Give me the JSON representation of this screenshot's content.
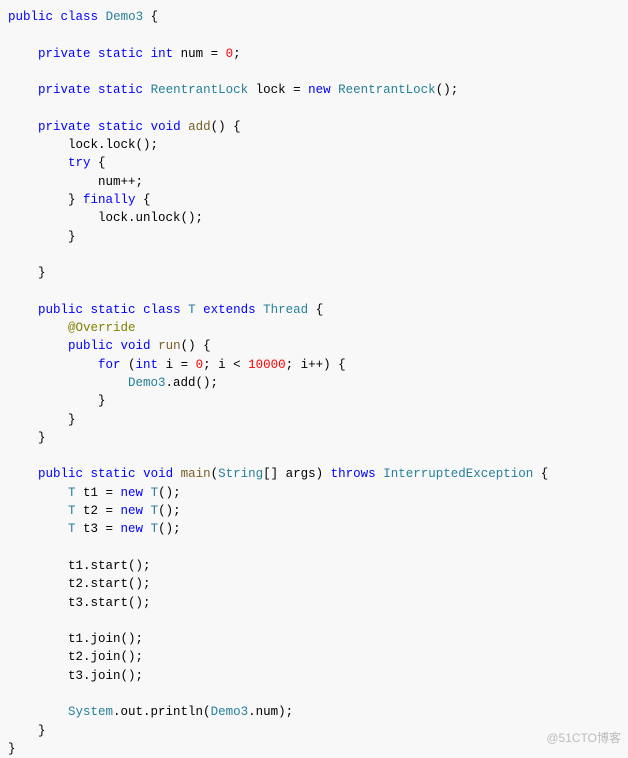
{
  "code": {
    "l1": {
      "t1": "public",
      "t2": "class",
      "t3": "Demo3",
      "t4": " {"
    },
    "l3": {
      "t1": "private",
      "t2": "static",
      "t3": "int",
      "t4": " num = ",
      "t5": "0",
      "t6": ";"
    },
    "l5": {
      "t1": "private",
      "t2": "static",
      "t3": "ReentrantLock",
      "t4": " lock = ",
      "t5": "new",
      "t6": "ReentrantLock",
      "t7": "();"
    },
    "l7": {
      "t1": "private",
      "t2": "static",
      "t3": "void",
      "t4": "add",
      "t5": "() {"
    },
    "l8": {
      "t1": "        lock.lock();"
    },
    "l9": {
      "t1": "try",
      "t2": " {"
    },
    "l10": {
      "t1": "            num++;"
    },
    "l11": {
      "t1": "} ",
      "t2": "finally",
      "t3": " {"
    },
    "l12": {
      "t1": "            lock.unlock();"
    },
    "l13": {
      "t1": "        }"
    },
    "l15": {
      "t1": "    }"
    },
    "l17": {
      "t1": "public",
      "t2": "static",
      "t3": "class",
      "t4": "T",
      "t5": "extends",
      "t6": "Thread",
      "t7": " {"
    },
    "l18": {
      "t1": "@Override"
    },
    "l19": {
      "t1": "public",
      "t2": "void",
      "t3": "run",
      "t4": "() {"
    },
    "l20": {
      "t1": "for",
      "t2": " (",
      "t3": "int",
      "t4": " i = ",
      "t5": "0",
      "t6": "; i < ",
      "t7": "10000",
      "t8": "; i++) {"
    },
    "l21": {
      "t1": "Demo3",
      "t2": ".add();"
    },
    "l22": {
      "t1": "            }"
    },
    "l23": {
      "t1": "        }"
    },
    "l24": {
      "t1": "    }"
    },
    "l26": {
      "t1": "public",
      "t2": "static",
      "t3": "void",
      "t4": "main",
      "t5": "(",
      "t6": "String",
      "t7": "[] args) ",
      "t8": "throws",
      "t9": "InterruptedException",
      "t10": " {"
    },
    "l27": {
      "t1": "T",
      "t2": " t1 = ",
      "t3": "new",
      "t4": "T",
      "t5": "();"
    },
    "l28": {
      "t1": "T",
      "t2": " t2 = ",
      "t3": "new",
      "t4": "T",
      "t5": "();"
    },
    "l29": {
      "t1": "T",
      "t2": " t3 = ",
      "t3": "new",
      "t4": "T",
      "t5": "();"
    },
    "l31": {
      "t1": "        t1.start();"
    },
    "l32": {
      "t1": "        t2.start();"
    },
    "l33": {
      "t1": "        t3.start();"
    },
    "l35": {
      "t1": "        t1.join();"
    },
    "l36": {
      "t1": "        t2.join();"
    },
    "l37": {
      "t1": "        t3.join();"
    },
    "l39": {
      "t1": "System",
      "t2": ".out.println(",
      "t3": "Demo3",
      "t4": ".num);"
    },
    "l40": {
      "t1": "    }"
    },
    "l41": {
      "t1": "}"
    }
  },
  "watermark": "@51CTO博客"
}
